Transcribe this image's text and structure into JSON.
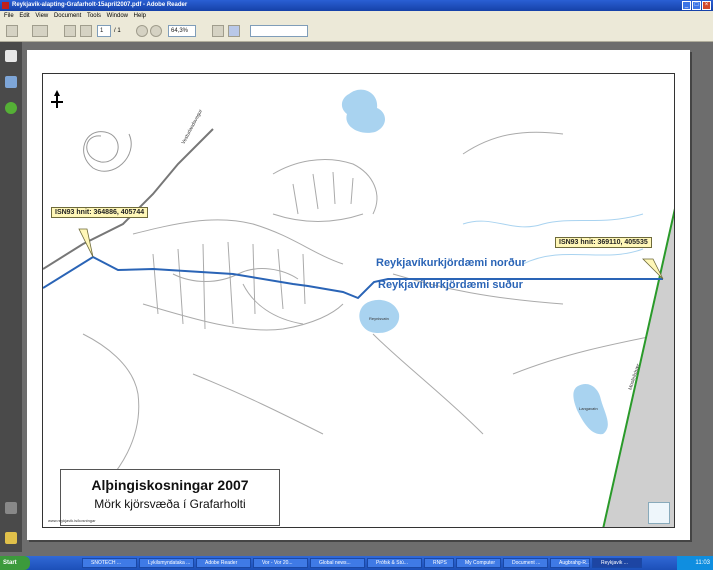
{
  "window": {
    "title": "Reykjavik-alapting-Grafarholt-15april2007.pdf - Adobe Reader"
  },
  "menu": [
    "File",
    "Edit",
    "View",
    "Document",
    "Tools",
    "Window",
    "Help"
  ],
  "toolbar": {
    "page_current": "1",
    "page_total": "/ 1",
    "zoom": "64,3%",
    "find_placeholder": "Find"
  },
  "map": {
    "callout_left": "ISN93 hnit: 364886, 405744",
    "callout_right": "ISN93 hnit: 369110, 405535",
    "label_north": "Reykjavíkurkjördæmi norður",
    "label_south": "Reykjavíkurkjördæmi suður",
    "road_label_1": "Vesturlandsvegur",
    "road_label_2": "Mosfellsbær",
    "lake_label_1": "Reynisvatn",
    "lake_label_2": "Langavatn",
    "title_main": "Alþingiskosningar 2007",
    "title_sub": "Mörk kjörsvæða í Grafarholti",
    "footer_small": "www.reykjavik.is/kosningar"
  },
  "taskbar": {
    "start": "Start",
    "items": [
      "SNOTECH ...",
      "Lykilsmyndataka ...",
      "Adobe Reader",
      "Vor - Vor 20...",
      "Global news...",
      "Prófsk & Stú...",
      "RNPS",
      "My Computer",
      "Document ...",
      "Augbrahg-R...",
      "Reykjavik ..."
    ],
    "clock": "11:03"
  },
  "colors": {
    "boundary": "#2a64b6",
    "water": "#a9d3f0",
    "road": "#9a9a9a",
    "municipal": "#cfcfcf",
    "municipal_edge": "#2a9a2a",
    "callout": "#fff7b8"
  }
}
